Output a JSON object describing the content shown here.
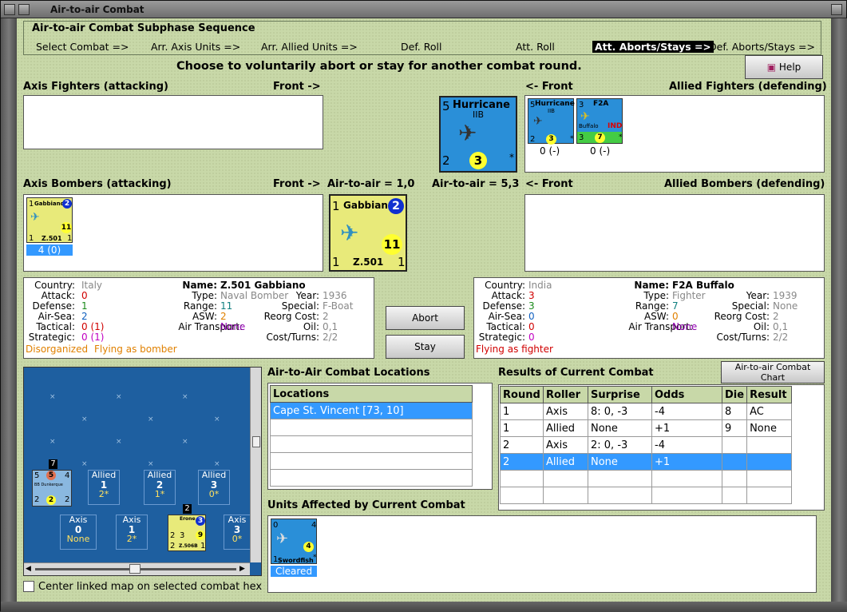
{
  "window": {
    "title": "Air-to-air Combat"
  },
  "sequence": {
    "title": "Air-to-air Combat Subphase Sequence",
    "steps": [
      "Select Combat =>",
      "Arr. Axis Units =>",
      "Arr. Allied Units =>",
      "Def. Roll",
      "Att. Roll",
      "Att. Aborts/Stays =>",
      "Def. Aborts/Stays =>"
    ],
    "active_index": 5
  },
  "instruction": "Choose to voluntarily abort or stay for another combat round.",
  "help_label": "Help",
  "sections": {
    "axis_fighters": "Axis Fighters (attacking)",
    "front_right_1": "Front ->",
    "front_left_1": "<- Front",
    "allied_fighters": "Allied Fighters (defending)",
    "axis_bombers": "Axis Bombers (attacking)",
    "front_right_2": "Front ->",
    "air_to_air_axis": "Air-to-air = 1,0",
    "air_to_air_allied": "Air-to-air = 5,3",
    "front_left_2": "<- Front",
    "allied_bombers": "Allied Bombers (defending)"
  },
  "big_allied_unit": {
    "name": "Hurricane",
    "sub": "IIB",
    "attack": "5",
    "defense": "2",
    "range": "3",
    "star": "*"
  },
  "allied_fighters": [
    {
      "name": "Hurricane",
      "sub": "IIB",
      "a": "5",
      "d": "2",
      "range": "3",
      "star": "*",
      "status": "0 (-)"
    },
    {
      "name": "F2A",
      "sub": "Buffalo",
      "a": "3",
      "d": "3",
      "range": "7",
      "star": "*",
      "tag": "IND",
      "status": "0 (-)"
    }
  ],
  "axis_bomber": {
    "name": "Gabbiano",
    "a": "1",
    "d": "1",
    "range": "11",
    "ranking": "2",
    "model": "Z.501",
    "status": "4 (0)"
  },
  "big_axis_unit": {
    "name": "Gabbiano",
    "a": "1",
    "d": "1",
    "range": "11",
    "ranking": "2",
    "model": "Z.501"
  },
  "axis_info": {
    "country_l": "Country:",
    "country": "Italy",
    "attack_l": "Attack:",
    "attack": "0",
    "defense_l": "Defense:",
    "defense": "1",
    "airsea_l": "Air-Sea:",
    "airsea": "2",
    "tactical_l": "Tactical:",
    "tactical": "0 (1)",
    "strategic_l": "Strategic:",
    "strategic": "0 (1)",
    "status1": "Disorganized",
    "status2": "Flying as bomber",
    "name_l": "Name:",
    "name": "Z.501 Gabbiano",
    "type_l": "Type:",
    "type": "Naval Bomber",
    "range_l": "Range:",
    "range": "11",
    "asw_l": "ASW:",
    "asw": "2",
    "airtransport_l": "Air Transport:",
    "airtransport": "None",
    "year_l": "Year:",
    "year": "1936",
    "special_l": "Special:",
    "special": "F-Boat",
    "reorg_l": "Reorg Cost:",
    "reorg": "2",
    "oil_l": "Oil:",
    "oil": "0,1",
    "cost_l": "Cost/Turns:",
    "cost": "2/2"
  },
  "allied_info": {
    "country_l": "Country:",
    "country": "India",
    "attack_l": "Attack:",
    "attack": "3",
    "defense_l": "Defense:",
    "defense": "3",
    "airsea_l": "Air-Sea:",
    "airsea": "0",
    "tactical_l": "Tactical:",
    "tactical": "0",
    "strategic_l": "Strategic:",
    "strategic": "0",
    "status": "Flying as fighter",
    "name_l": "Name:",
    "name": "F2A Buffalo",
    "type_l": "Type:",
    "type": "Fighter",
    "range_l": "Range:",
    "range": "7",
    "asw_l": "ASW:",
    "asw": "0",
    "airtransport_l": "Air Transport:",
    "airtransport": "None",
    "year_l": "Year:",
    "year": "1939",
    "special_l": "Special:",
    "special": "None",
    "reorg_l": "Reorg Cost:",
    "reorg": "2",
    "oil_l": "Oil:",
    "oil": "0,1",
    "cost_l": "Cost/Turns:",
    "cost": "2/2"
  },
  "buttons": {
    "abort": "Abort",
    "stay": "Stay",
    "chart": "Air-to-air Combat Chart"
  },
  "map": {
    "boxes_top": [
      {
        "side": "Allied",
        "num": "1",
        "val": "2*"
      },
      {
        "side": "Allied",
        "num": "2",
        "val": "1*"
      },
      {
        "side": "Allied",
        "num": "3",
        "val": "0*"
      }
    ],
    "boxes_bottom": [
      {
        "side": "Axis",
        "num": "0",
        "val": "None"
      },
      {
        "side": "Axis",
        "num": "1",
        "val": "2*"
      },
      {
        "side": "Axis",
        "num": "3",
        "val": "0*"
      }
    ],
    "ship": {
      "stack": "7",
      "a": "5",
      "b": "5",
      "c": "4",
      "d": "2",
      "e": "2",
      "f": "2",
      "name": "BB Dunkerque"
    },
    "plane": {
      "stack": "2",
      "name": "Erone",
      "a": "2",
      "b": "3",
      "range": "9",
      "d": "1",
      "model": "Z.506B",
      "ranking": "3"
    }
  },
  "center_checkbox_label": "Center linked map on selected combat hex",
  "locations": {
    "title": "Air-to-Air Combat Locations",
    "header": "Locations",
    "rows": [
      "Cape St. Vincent [73, 10]"
    ]
  },
  "results": {
    "title": "Results of Current Combat",
    "headers": [
      "Round",
      "Roller",
      "Surprise",
      "Odds",
      "Die",
      "Result"
    ],
    "rows": [
      [
        "1",
        "Axis",
        "8: 0, -3",
        "-4",
        "8",
        "AC"
      ],
      [
        "1",
        "Allied",
        "None",
        "+1",
        "9",
        "None"
      ],
      [
        "2",
        "Axis",
        "2: 0, -3",
        "-4",
        "",
        ""
      ],
      [
        "2",
        "Allied",
        "None",
        "+1",
        "",
        ""
      ]
    ],
    "selected_row": 3
  },
  "affected": {
    "title": "Units Affected by Current Combat",
    "unit": {
      "name": "Swordfish",
      "a": "0",
      "b": "4",
      "d": "1",
      "range": "4",
      "star": "*",
      "status": "Cleared"
    }
  }
}
